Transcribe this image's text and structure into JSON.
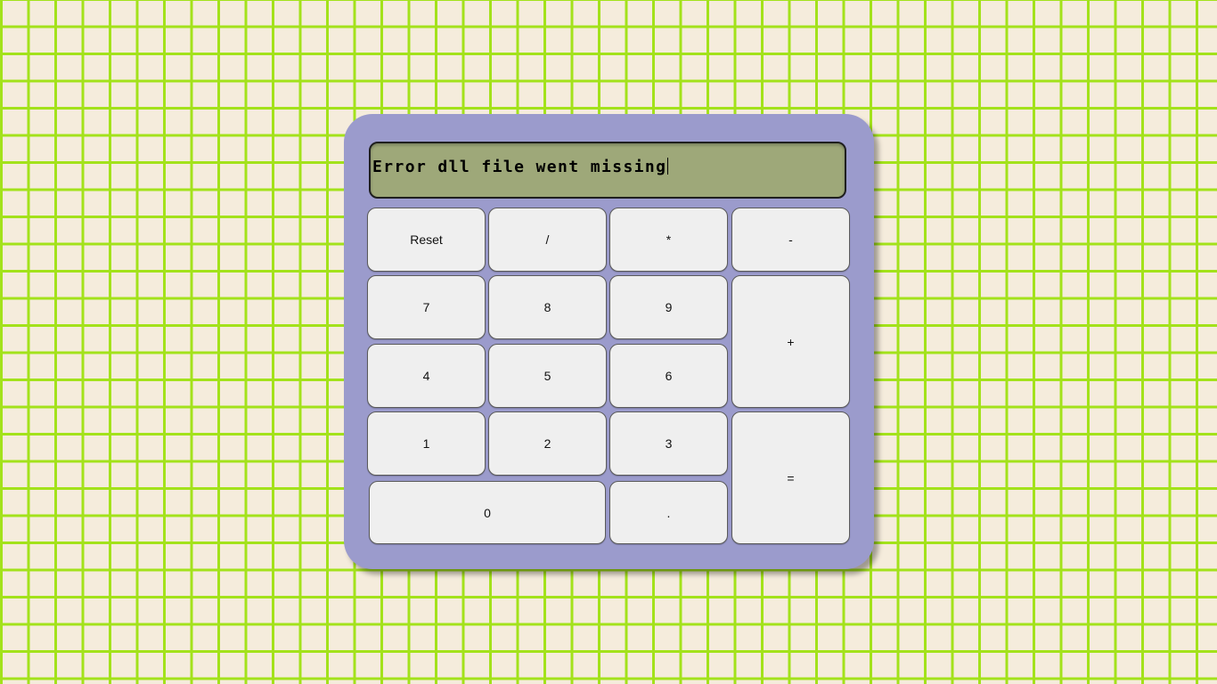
{
  "display": {
    "text": "Error dll file went missing"
  },
  "keys": {
    "reset": "Reset",
    "divide": "/",
    "multiply": "*",
    "subtract": "-",
    "seven": "7",
    "eight": "8",
    "nine": "9",
    "add": "+",
    "four": "4",
    "five": "5",
    "six": "6",
    "one": "1",
    "two": "2",
    "three": "3",
    "equals": "=",
    "zero": "0",
    "decimal": "."
  },
  "colors": {
    "page_background": "#f5ecdc",
    "grid_lines": "#a3e21b",
    "calculator_body": "#9b9bcc",
    "display_background": "#9ea879",
    "key_background": "#efefef"
  }
}
